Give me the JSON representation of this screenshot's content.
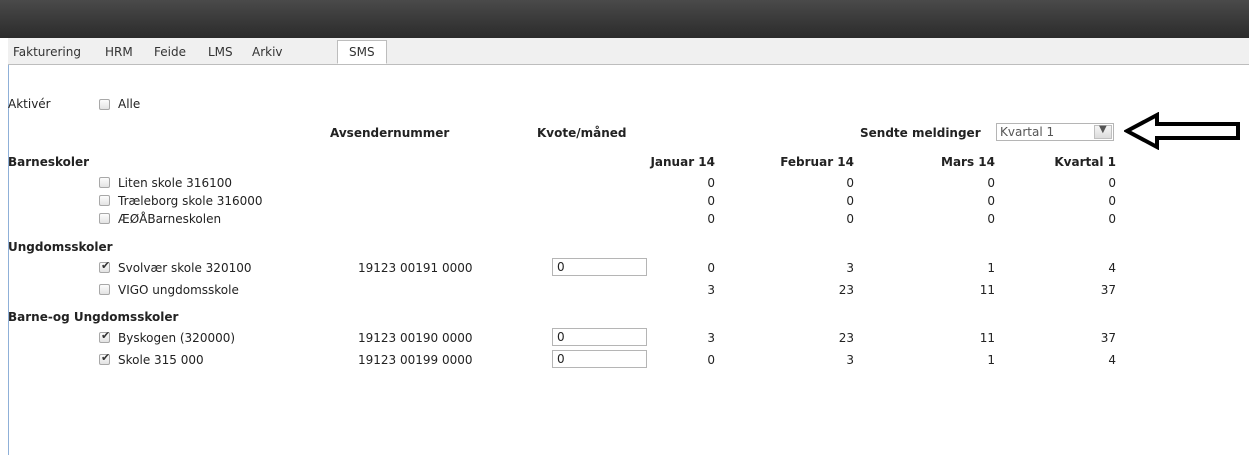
{
  "tabs": [
    "Fakturering",
    "HRM",
    "Feide",
    "LMS",
    "Arkiv",
    "SMS"
  ],
  "activate": {
    "label": "Aktivér",
    "all_label": "Alle"
  },
  "columns": {
    "sender": "Avsendernummer",
    "quota": "Kvote/måned",
    "sent_label": "Sendte meldinger",
    "period_select": "Kvartal 1",
    "months": [
      "Januar 14",
      "Februar 14",
      "Mars 14",
      "Kvartal 1"
    ]
  },
  "groups": [
    {
      "name": "Barneskoler",
      "rows": [
        {
          "name": "Liten skole 316100",
          "checked": false,
          "sender": "",
          "quota": null,
          "values": [
            "0",
            "0",
            "0",
            "0"
          ]
        },
        {
          "name": "Træleborg skole 316000",
          "checked": false,
          "sender": "",
          "quota": null,
          "values": [
            "0",
            "0",
            "0",
            "0"
          ]
        },
        {
          "name": "ÆØÅBarneskolen",
          "checked": false,
          "sender": "",
          "quota": null,
          "values": [
            "0",
            "0",
            "0",
            "0"
          ]
        }
      ]
    },
    {
      "name": "Ungdomsskoler",
      "rows": [
        {
          "name": "Svolvær skole 320100",
          "checked": true,
          "sender": "19123 00191 0000",
          "quota": "0",
          "values": [
            "0",
            "3",
            "1",
            "4"
          ]
        },
        {
          "name": "VIGO ungdomsskole",
          "checked": false,
          "sender": "",
          "quota": null,
          "values": [
            "3",
            "23",
            "11",
            "37"
          ]
        }
      ]
    },
    {
      "name": "Barne-og Ungdomsskoler",
      "rows": [
        {
          "name": "Byskogen (320000)",
          "checked": true,
          "sender": "19123 00190 0000",
          "quota": "0",
          "values": [
            "3",
            "23",
            "11",
            "37"
          ]
        },
        {
          "name": "Skole 315 000",
          "checked": true,
          "sender": "19123 00199 0000",
          "quota": "0",
          "values": [
            "0",
            "3",
            "1",
            "4"
          ]
        }
      ]
    }
  ],
  "annotation": {
    "icon": "left-arrow-outline-icon"
  }
}
